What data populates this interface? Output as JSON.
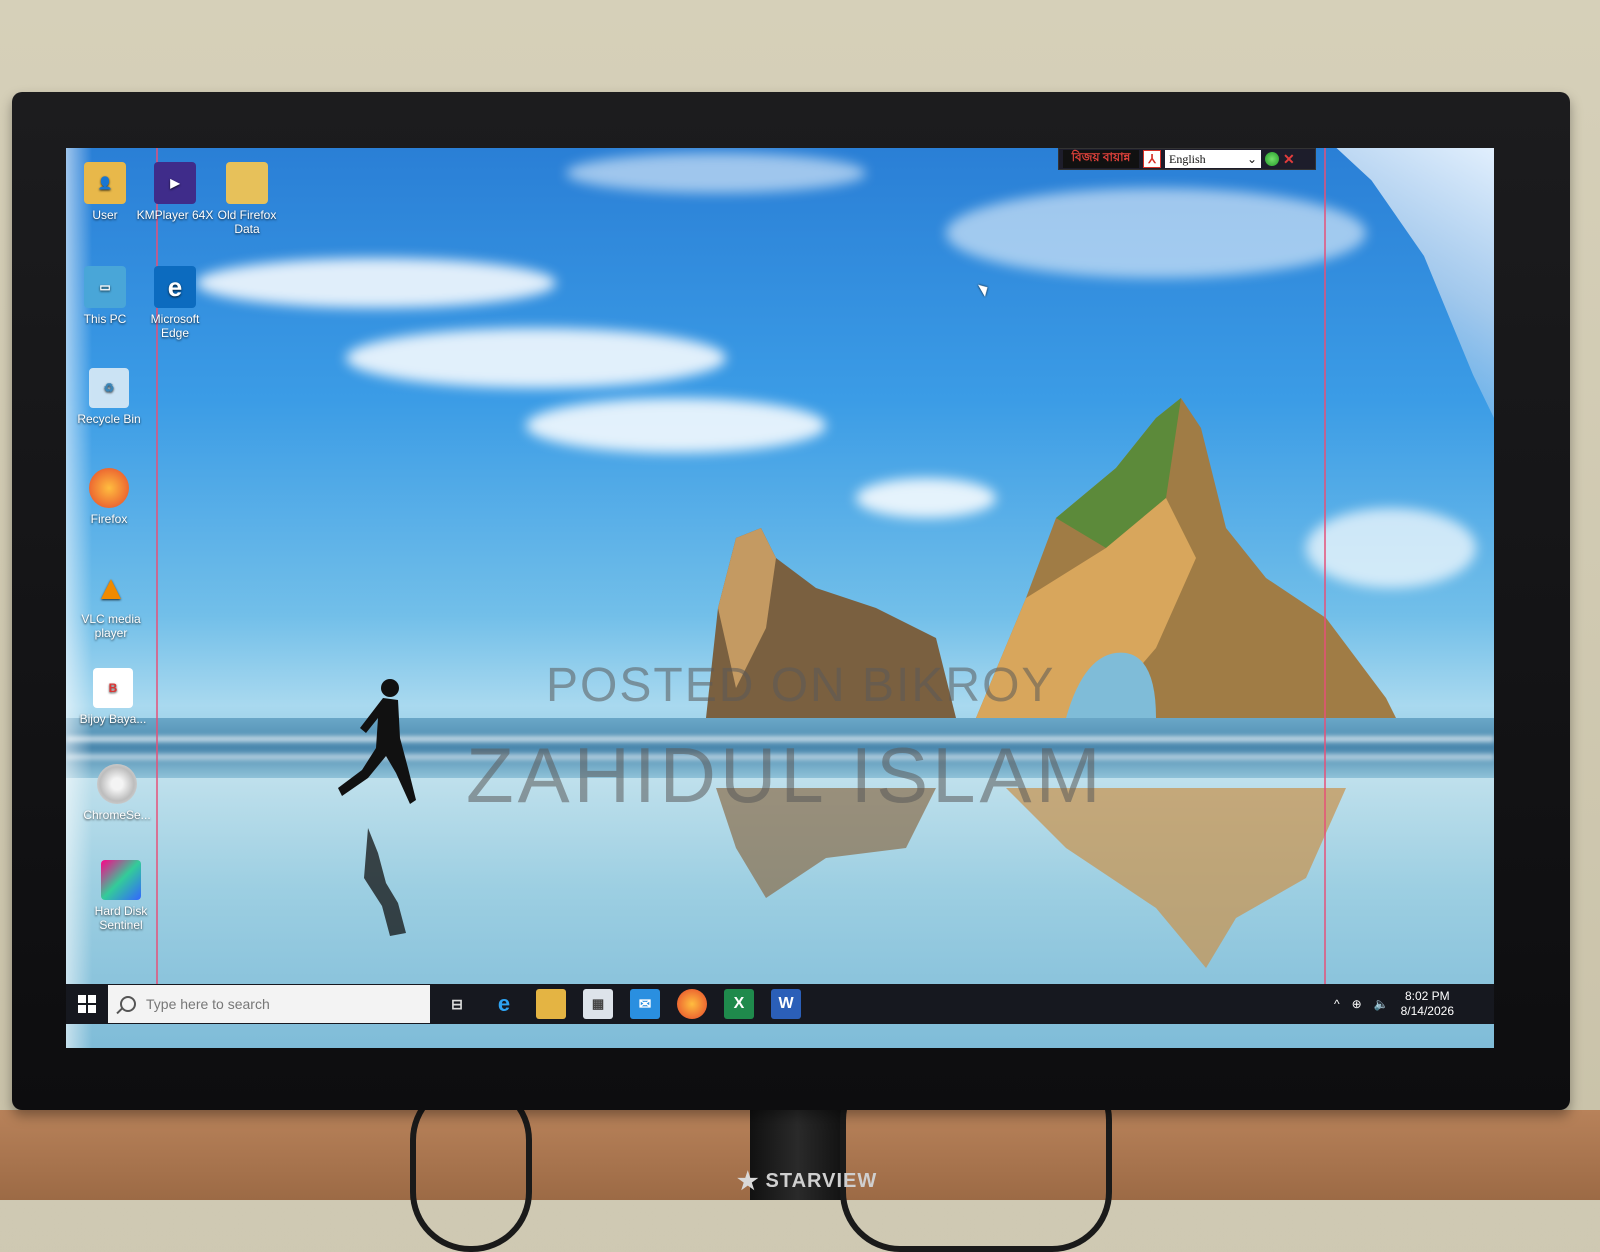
{
  "monitor": {
    "brand": "STARVIEW"
  },
  "watermark": {
    "line1": "POSTED ON BIKROY",
    "line2": "ZAHIDUL ISLAM"
  },
  "desktop_icons": [
    {
      "label": "User",
      "icon": "user-folder-icon"
    },
    {
      "label": "KMPlayer 64X",
      "icon": "kmplayer-icon"
    },
    {
      "label": "Old Firefox Data",
      "icon": "folder-icon"
    },
    {
      "label": "This PC",
      "icon": "this-pc-icon"
    },
    {
      "label": "Microsoft Edge",
      "icon": "edge-icon"
    },
    {
      "label": "Recycle Bin",
      "icon": "recycle-bin-icon"
    },
    {
      "label": "Firefox",
      "icon": "firefox-icon"
    },
    {
      "label": "VLC media player",
      "icon": "vlc-icon"
    },
    {
      "label": "Bijoy Baya...",
      "icon": "bijoy-icon"
    },
    {
      "label": "ChromeSe...",
      "icon": "cd-icon"
    },
    {
      "label": "Hard Disk Sentinel",
      "icon": "hard-disk-sentinel-icon"
    }
  ],
  "language_bar": {
    "logo_text": "বিজয় বায়ান্ন",
    "language": "English"
  },
  "taskbar": {
    "search_placeholder": "Type here to search",
    "pinned": [
      "task-view-icon",
      "edge-icon",
      "file-explorer-icon",
      "store-icon",
      "mail-icon",
      "firefox-icon",
      "excel-icon",
      "word-icon"
    ],
    "time": "8:02 PM",
    "date": "8/14/2026"
  },
  "colors": {
    "taskbar": "#16181f",
    "sky_top": "#2a7fd6",
    "accent": "#0078d7"
  }
}
